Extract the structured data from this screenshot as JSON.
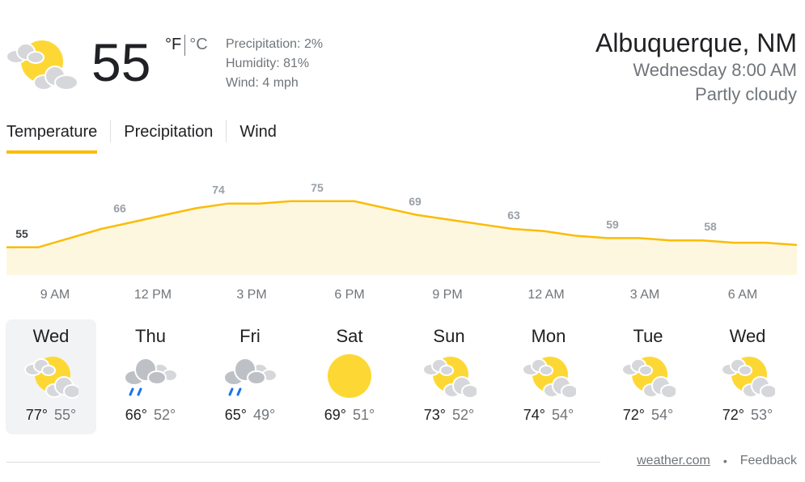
{
  "current": {
    "temperature": "55",
    "unit_f": "°F",
    "unit_c": "°C",
    "precipitation": "Precipitation: 2%",
    "humidity": "Humidity: 81%",
    "wind": "Wind: 4 mph",
    "icon": "partly-cloudy-icon"
  },
  "location": {
    "city": "Albuquerque, NM",
    "datetime": "Wednesday 8:00 AM",
    "condition": "Partly cloudy"
  },
  "tabs": [
    {
      "label": "Temperature",
      "active": true
    },
    {
      "label": "Precipitation",
      "active": false
    },
    {
      "label": "Wind",
      "active": false
    }
  ],
  "chart_data": {
    "type": "area",
    "x": [
      "9 AM",
      "12 PM",
      "3 PM",
      "6 PM",
      "9 PM",
      "12 AM",
      "3 AM",
      "6 AM"
    ],
    "labeled_values": [
      55,
      66,
      74,
      75,
      69,
      63,
      59,
      58
    ],
    "hourly_values": [
      55,
      55,
      59,
      63,
      66,
      69,
      72,
      74,
      74,
      75,
      75,
      75,
      72,
      69,
      67,
      65,
      63,
      62,
      60,
      59,
      59,
      58,
      58,
      57,
      57,
      56
    ],
    "colors": {
      "line": "#fbbc04",
      "fill": "#fef7e0",
      "label": "#9aa0a6"
    }
  },
  "forecast": [
    {
      "day": "Wed",
      "hi": "77°",
      "lo": "55°",
      "icon": "partly-cloudy-icon",
      "selected": true
    },
    {
      "day": "Thu",
      "hi": "66°",
      "lo": "52°",
      "icon": "rain-icon",
      "selected": false
    },
    {
      "day": "Fri",
      "hi": "65°",
      "lo": "49°",
      "icon": "rain-icon",
      "selected": false
    },
    {
      "day": "Sat",
      "hi": "69°",
      "lo": "51°",
      "icon": "sun-icon",
      "selected": false
    },
    {
      "day": "Sun",
      "hi": "73°",
      "lo": "52°",
      "icon": "partly-cloudy-icon",
      "selected": false
    },
    {
      "day": "Mon",
      "hi": "74°",
      "lo": "54°",
      "icon": "partly-cloudy-icon",
      "selected": false
    },
    {
      "day": "Tue",
      "hi": "72°",
      "lo": "54°",
      "icon": "partly-cloudy-icon",
      "selected": false
    },
    {
      "day": "Wed",
      "hi": "72°",
      "lo": "53°",
      "icon": "partly-cloudy-icon",
      "selected": false
    }
  ],
  "footer": {
    "source": "weather.com",
    "separator": "•",
    "feedback": "Feedback"
  }
}
